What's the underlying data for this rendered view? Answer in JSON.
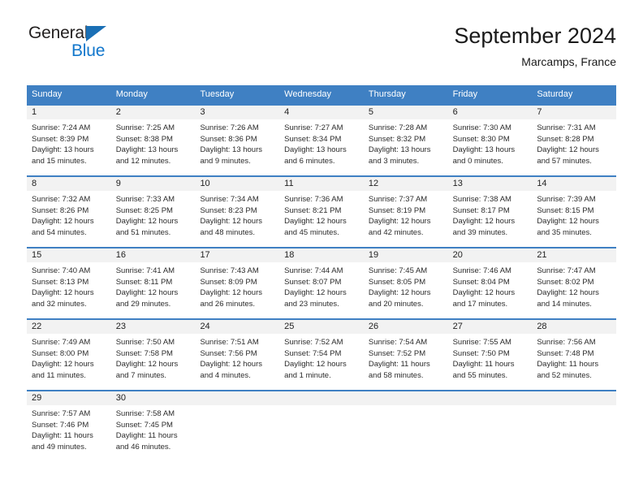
{
  "brand": {
    "name_part1": "General",
    "name_part2": "Blue",
    "logo_icon": "blue-triangle-icon"
  },
  "header": {
    "title": "September 2024",
    "location": "Marcamps, France"
  },
  "calendar": {
    "weekdays": [
      "Sunday",
      "Monday",
      "Tuesday",
      "Wednesday",
      "Thursday",
      "Friday",
      "Saturday"
    ],
    "header_color": "#3f80c3",
    "day_strip_color": "#f2f2f2",
    "labels": {
      "sunrise": "Sunrise:",
      "sunset": "Sunset:",
      "daylight": "Daylight:"
    },
    "weeks": [
      [
        {
          "day": "1",
          "sunrise": "Sunrise: 7:24 AM",
          "sunset": "Sunset: 8:39 PM",
          "daylight_line1": "Daylight: 13 hours",
          "daylight_line2": "and 15 minutes."
        },
        {
          "day": "2",
          "sunrise": "Sunrise: 7:25 AM",
          "sunset": "Sunset: 8:38 PM",
          "daylight_line1": "Daylight: 13 hours",
          "daylight_line2": "and 12 minutes."
        },
        {
          "day": "3",
          "sunrise": "Sunrise: 7:26 AM",
          "sunset": "Sunset: 8:36 PM",
          "daylight_line1": "Daylight: 13 hours",
          "daylight_line2": "and 9 minutes."
        },
        {
          "day": "4",
          "sunrise": "Sunrise: 7:27 AM",
          "sunset": "Sunset: 8:34 PM",
          "daylight_line1": "Daylight: 13 hours",
          "daylight_line2": "and 6 minutes."
        },
        {
          "day": "5",
          "sunrise": "Sunrise: 7:28 AM",
          "sunset": "Sunset: 8:32 PM",
          "daylight_line1": "Daylight: 13 hours",
          "daylight_line2": "and 3 minutes."
        },
        {
          "day": "6",
          "sunrise": "Sunrise: 7:30 AM",
          "sunset": "Sunset: 8:30 PM",
          "daylight_line1": "Daylight: 13 hours",
          "daylight_line2": "and 0 minutes."
        },
        {
          "day": "7",
          "sunrise": "Sunrise: 7:31 AM",
          "sunset": "Sunset: 8:28 PM",
          "daylight_line1": "Daylight: 12 hours",
          "daylight_line2": "and 57 minutes."
        }
      ],
      [
        {
          "day": "8",
          "sunrise": "Sunrise: 7:32 AM",
          "sunset": "Sunset: 8:26 PM",
          "daylight_line1": "Daylight: 12 hours",
          "daylight_line2": "and 54 minutes."
        },
        {
          "day": "9",
          "sunrise": "Sunrise: 7:33 AM",
          "sunset": "Sunset: 8:25 PM",
          "daylight_line1": "Daylight: 12 hours",
          "daylight_line2": "and 51 minutes."
        },
        {
          "day": "10",
          "sunrise": "Sunrise: 7:34 AM",
          "sunset": "Sunset: 8:23 PM",
          "daylight_line1": "Daylight: 12 hours",
          "daylight_line2": "and 48 minutes."
        },
        {
          "day": "11",
          "sunrise": "Sunrise: 7:36 AM",
          "sunset": "Sunset: 8:21 PM",
          "daylight_line1": "Daylight: 12 hours",
          "daylight_line2": "and 45 minutes."
        },
        {
          "day": "12",
          "sunrise": "Sunrise: 7:37 AM",
          "sunset": "Sunset: 8:19 PM",
          "daylight_line1": "Daylight: 12 hours",
          "daylight_line2": "and 42 minutes."
        },
        {
          "day": "13",
          "sunrise": "Sunrise: 7:38 AM",
          "sunset": "Sunset: 8:17 PM",
          "daylight_line1": "Daylight: 12 hours",
          "daylight_line2": "and 39 minutes."
        },
        {
          "day": "14",
          "sunrise": "Sunrise: 7:39 AM",
          "sunset": "Sunset: 8:15 PM",
          "daylight_line1": "Daylight: 12 hours",
          "daylight_line2": "and 35 minutes."
        }
      ],
      [
        {
          "day": "15",
          "sunrise": "Sunrise: 7:40 AM",
          "sunset": "Sunset: 8:13 PM",
          "daylight_line1": "Daylight: 12 hours",
          "daylight_line2": "and 32 minutes."
        },
        {
          "day": "16",
          "sunrise": "Sunrise: 7:41 AM",
          "sunset": "Sunset: 8:11 PM",
          "daylight_line1": "Daylight: 12 hours",
          "daylight_line2": "and 29 minutes."
        },
        {
          "day": "17",
          "sunrise": "Sunrise: 7:43 AM",
          "sunset": "Sunset: 8:09 PM",
          "daylight_line1": "Daylight: 12 hours",
          "daylight_line2": "and 26 minutes."
        },
        {
          "day": "18",
          "sunrise": "Sunrise: 7:44 AM",
          "sunset": "Sunset: 8:07 PM",
          "daylight_line1": "Daylight: 12 hours",
          "daylight_line2": "and 23 minutes."
        },
        {
          "day": "19",
          "sunrise": "Sunrise: 7:45 AM",
          "sunset": "Sunset: 8:05 PM",
          "daylight_line1": "Daylight: 12 hours",
          "daylight_line2": "and 20 minutes."
        },
        {
          "day": "20",
          "sunrise": "Sunrise: 7:46 AM",
          "sunset": "Sunset: 8:04 PM",
          "daylight_line1": "Daylight: 12 hours",
          "daylight_line2": "and 17 minutes."
        },
        {
          "day": "21",
          "sunrise": "Sunrise: 7:47 AM",
          "sunset": "Sunset: 8:02 PM",
          "daylight_line1": "Daylight: 12 hours",
          "daylight_line2": "and 14 minutes."
        }
      ],
      [
        {
          "day": "22",
          "sunrise": "Sunrise: 7:49 AM",
          "sunset": "Sunset: 8:00 PM",
          "daylight_line1": "Daylight: 12 hours",
          "daylight_line2": "and 11 minutes."
        },
        {
          "day": "23",
          "sunrise": "Sunrise: 7:50 AM",
          "sunset": "Sunset: 7:58 PM",
          "daylight_line1": "Daylight: 12 hours",
          "daylight_line2": "and 7 minutes."
        },
        {
          "day": "24",
          "sunrise": "Sunrise: 7:51 AM",
          "sunset": "Sunset: 7:56 PM",
          "daylight_line1": "Daylight: 12 hours",
          "daylight_line2": "and 4 minutes."
        },
        {
          "day": "25",
          "sunrise": "Sunrise: 7:52 AM",
          "sunset": "Sunset: 7:54 PM",
          "daylight_line1": "Daylight: 12 hours",
          "daylight_line2": "and 1 minute."
        },
        {
          "day": "26",
          "sunrise": "Sunrise: 7:54 AM",
          "sunset": "Sunset: 7:52 PM",
          "daylight_line1": "Daylight: 11 hours",
          "daylight_line2": "and 58 minutes."
        },
        {
          "day": "27",
          "sunrise": "Sunrise: 7:55 AM",
          "sunset": "Sunset: 7:50 PM",
          "daylight_line1": "Daylight: 11 hours",
          "daylight_line2": "and 55 minutes."
        },
        {
          "day": "28",
          "sunrise": "Sunrise: 7:56 AM",
          "sunset": "Sunset: 7:48 PM",
          "daylight_line1": "Daylight: 11 hours",
          "daylight_line2": "and 52 minutes."
        }
      ],
      [
        {
          "day": "29",
          "sunrise": "Sunrise: 7:57 AM",
          "sunset": "Sunset: 7:46 PM",
          "daylight_line1": "Daylight: 11 hours",
          "daylight_line2": "and 49 minutes."
        },
        {
          "day": "30",
          "sunrise": "Sunrise: 7:58 AM",
          "sunset": "Sunset: 7:45 PM",
          "daylight_line1": "Daylight: 11 hours",
          "daylight_line2": "and 46 minutes."
        },
        {
          "day": "",
          "sunrise": "",
          "sunset": "",
          "daylight_line1": "",
          "daylight_line2": ""
        },
        {
          "day": "",
          "sunrise": "",
          "sunset": "",
          "daylight_line1": "",
          "daylight_line2": ""
        },
        {
          "day": "",
          "sunrise": "",
          "sunset": "",
          "daylight_line1": "",
          "daylight_line2": ""
        },
        {
          "day": "",
          "sunrise": "",
          "sunset": "",
          "daylight_line1": "",
          "daylight_line2": ""
        },
        {
          "day": "",
          "sunrise": "",
          "sunset": "",
          "daylight_line1": "",
          "daylight_line2": ""
        }
      ]
    ]
  }
}
